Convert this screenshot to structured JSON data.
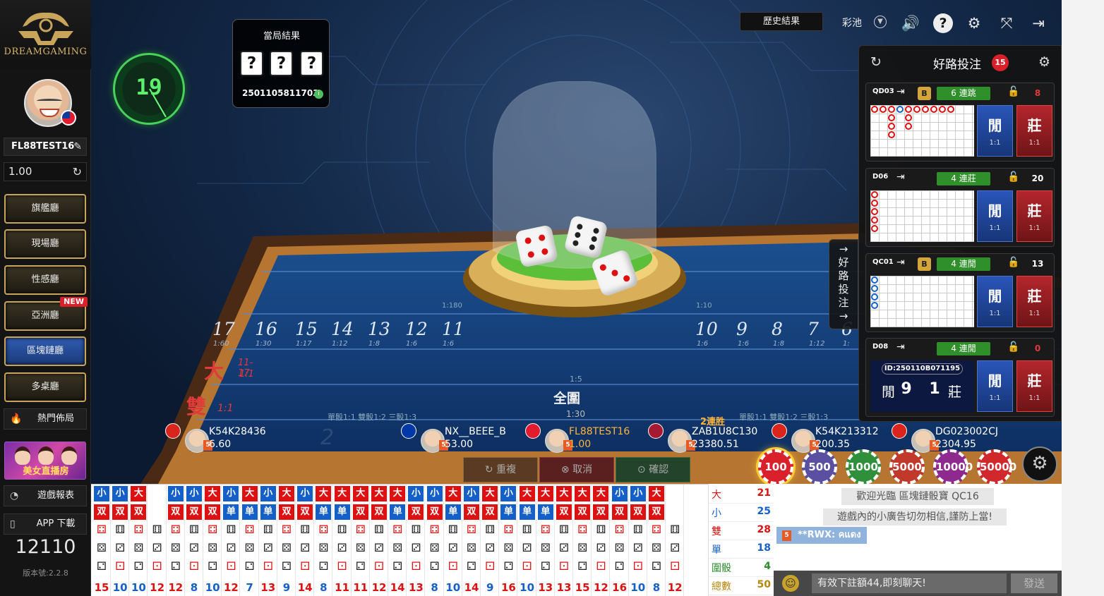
{
  "brand": {
    "name": "DREAMGAMING"
  },
  "user": {
    "name": "FL88TEST16",
    "balance": "1.00"
  },
  "halls": [
    {
      "label": "旗艦廳",
      "new": ""
    },
    {
      "label": "現場廳",
      "new": ""
    },
    {
      "label": "性感廳",
      "new": ""
    },
    {
      "label": "亞洲廳",
      "new": "NEW"
    },
    {
      "label": "區塊鏈廳",
      "new": ""
    },
    {
      "label": "多桌廳",
      "new": ""
    }
  ],
  "side_links": {
    "hot": "熱門佈局",
    "promo": "美女直播房",
    "report": "遊戲報表",
    "app": "APP 下載"
  },
  "counter": "12110",
  "version": "版本號:2.2.8",
  "timer": "19",
  "current_result": {
    "title": "當局結果",
    "dice": [
      "?",
      "?",
      "?"
    ],
    "round_id": "2501105811703"
  },
  "topbar": {
    "history": "歷史結果",
    "pool": "彩池"
  },
  "icons": {
    "sound": "speaker-icon",
    "help": "help-icon",
    "settings": "gear-icon",
    "fullscreen": "fullscreen-icon",
    "exit": "exit-icon"
  },
  "bet_areas": {
    "big": "大",
    "big_range": "11-17",
    "big_odds": "1:1",
    "even": "雙",
    "even_odds": "1:1",
    "triple_any": "全圍",
    "triple_any_odds": "1:30",
    "triple_specific_odds": "1:180",
    "double_odds": "1:10",
    "odds_hint": "單骰1:1 雙骰1:2 三骰1:3",
    "sums_left": [
      {
        "n": "17",
        "o": "1:60"
      },
      {
        "n": "16",
        "o": "1:30"
      },
      {
        "n": "15",
        "o": "1:17"
      },
      {
        "n": "14",
        "o": "1:12"
      },
      {
        "n": "13",
        "o": "1:8"
      },
      {
        "n": "12",
        "o": "1:6"
      },
      {
        "n": "11",
        "o": "1:6"
      }
    ],
    "sums_right": [
      {
        "n": "10",
        "o": "1:6"
      },
      {
        "n": "9",
        "o": "1:6"
      },
      {
        "n": "8",
        "o": "1:8"
      },
      {
        "n": "7",
        "o": "1:12"
      },
      {
        "n": "6",
        "o": "1:"
      }
    ],
    "combo_odds": "1:5"
  },
  "seat_marker": "2",
  "players": [
    {
      "name": "K54K28436",
      "balance": "6.60",
      "flag": "#da251d",
      "highlight": false
    },
    {
      "name": "NX__BEEE_B",
      "balance": "53.00",
      "flag": "#0038a8",
      "highlight": false
    },
    {
      "name": "FL88TEST16",
      "balance": "1.00",
      "flag": "#e21c2e",
      "highlight": true
    },
    {
      "name": "ZAB1U8C130",
      "balance": "23380.51",
      "flag": "#a51931",
      "highlight": false,
      "streak": "2連胜"
    },
    {
      "name": "K54K213312",
      "balance": "200.35",
      "flag": "#da251d",
      "highlight": false
    },
    {
      "name": "DG023002CJ",
      "balance": "2304.95",
      "flag": "#da251d",
      "highlight": false
    }
  ],
  "actions": {
    "repeat": "重複",
    "cancel": "取消",
    "confirm": "確認"
  },
  "chips": [
    {
      "v": "100",
      "color": "#d9202b"
    },
    {
      "v": "500",
      "color": "#5a4fa0"
    },
    {
      "v": "1000",
      "color": "#2f8f3a"
    },
    {
      "v": "5000",
      "color": "#c0392b"
    },
    {
      "v": "10000",
      "color": "#8e2a8e"
    },
    {
      "v": "50000",
      "color": "#d1282b"
    }
  ],
  "road_panel": {
    "title": "好路投注",
    "count": "15",
    "tab_label": "好路投注",
    "xian": "閒",
    "zhuang": "莊",
    "odds": "1:1",
    "tables": [
      {
        "id": "QD03",
        "streak": "6 連跳",
        "num": "8",
        "num_color": "#e03a3a",
        "bookmark": true
      },
      {
        "id": "D06",
        "streak": "4 連莊",
        "num": "20",
        "num_color": "#ffffff",
        "bookmark": false
      },
      {
        "id": "QC01",
        "streak": "4 連閒",
        "num": "13",
        "num_color": "#ffffff",
        "bookmark": true
      },
      {
        "id": "D08",
        "streak": "4 連閒",
        "num": "0",
        "num_color": "#e03a3a",
        "bookmark": false
      }
    ],
    "last_result": {
      "round_id": "ID:250110B071195",
      "xian_label": "閒",
      "xian_score": "9",
      "zhuang_score": "1",
      "zhuang_label": "莊"
    }
  },
  "bead_road": {
    "bigsmall": [
      "小",
      "小",
      "大",
      "",
      "小",
      "小",
      "大",
      "小",
      "大",
      "小",
      "大",
      "小",
      "大",
      "大",
      "大",
      "大",
      "大",
      "小",
      "小",
      "大",
      "小",
      "大",
      "小",
      "大",
      "大",
      "大",
      "大",
      "大",
      "小",
      "小",
      "大"
    ],
    "oddeven": [
      "双",
      "双",
      "双",
      "",
      "双",
      "双",
      "双",
      "单",
      "单",
      "单",
      "双",
      "双",
      "单",
      "单",
      "双",
      "双",
      "单",
      "双",
      "双",
      "单",
      "双",
      "双",
      "单",
      "单",
      "单",
      "双",
      "双",
      "双",
      "双",
      "双",
      "双"
    ],
    "sums": [
      "15",
      "10",
      "10",
      "12",
      "12",
      "8",
      "10",
      "12",
      "7",
      "13",
      "9",
      "14",
      "8",
      "11",
      "11",
      "12",
      "14",
      "13",
      "8",
      "10",
      "14",
      "9",
      "16",
      "10",
      "13",
      "13",
      "15",
      "12",
      "16",
      "10",
      "8",
      "12"
    ]
  },
  "stats": [
    {
      "k": "大",
      "v": "21",
      "kc": "#d11",
      "vc": "#d11"
    },
    {
      "k": "小",
      "v": "25",
      "kc": "#1560c8",
      "vc": "#1560c8"
    },
    {
      "k": "雙",
      "v": "28",
      "kc": "#d11",
      "vc": "#d11"
    },
    {
      "k": "單",
      "v": "18",
      "kc": "#1560c8",
      "vc": "#1560c8"
    },
    {
      "k": "圍骰",
      "v": "4",
      "kc": "#2a8f2a",
      "vc": "#2a8f2a"
    },
    {
      "k": "總數",
      "v": "50",
      "kc": "#b8860b",
      "vc": "#b8860b"
    }
  ],
  "chat": {
    "welcome": "歡迎光臨 區塊鏈骰寶 QC16",
    "warning": "遊戲內的小廣告切勿相信,謹防上當!",
    "user_msg": "**RWX: คแดง",
    "placeholder": "有效下註額44,即刻聊天!",
    "send": "發送"
  }
}
